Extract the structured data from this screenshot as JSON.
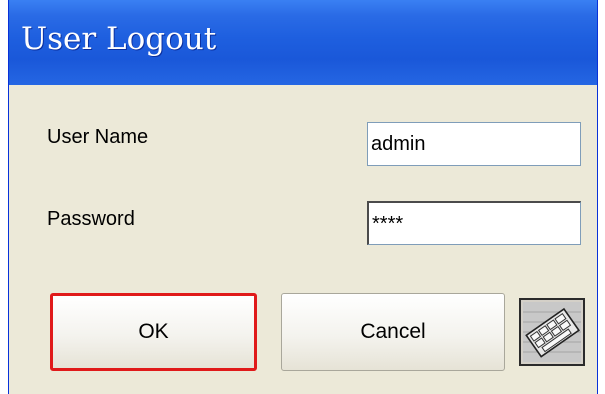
{
  "dialog": {
    "title": "User Logout"
  },
  "form": {
    "username_label": "User Name",
    "username_value": "admin",
    "password_label": "Password",
    "password_value": "****"
  },
  "buttons": {
    "ok_label": "OK",
    "cancel_label": "Cancel",
    "keyboard_icon": "keyboard-icon"
  },
  "colors": {
    "titlebar": "#1e5fdf",
    "dialog_bg": "#ece9d8",
    "focus_border": "#e01a1a"
  }
}
